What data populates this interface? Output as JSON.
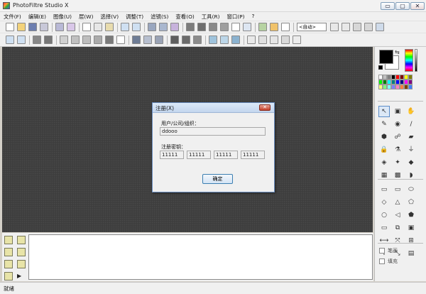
{
  "window": {
    "title": "PhotoFiltre Studio X",
    "controls": {
      "minimize": "▭",
      "maximize": "▢",
      "close": "✕"
    }
  },
  "menu": [
    "文件(F)",
    "编辑(E)",
    "图像(U)",
    "层(W)",
    "选择(V)",
    "调整(T)",
    "滤镜(S)",
    "查看(O)",
    "工具(R)",
    "窗口(P)",
    "?"
  ],
  "toolbar": {
    "zoom_value": "<自动>"
  },
  "dialog": {
    "title": "注册(X)",
    "close": "✕",
    "user_label": "用户/公司/组织：",
    "user_value": "ddooo",
    "key_label": "注册密钥：",
    "key_parts": [
      "11111",
      "11111",
      "11111",
      "11111"
    ],
    "ok_label": "确定"
  },
  "palette": {
    "swatches": [
      "#ffffff",
      "#c0c0c0",
      "#808080",
      "#000000",
      "#ff0000",
      "#800000",
      "#ffff00",
      "#808000",
      "#00ff00",
      "#008000",
      "#00ffff",
      "#008080",
      "#0000ff",
      "#000080",
      "#ff00ff",
      "#800080",
      "#ffff80",
      "#80ff80",
      "#80ffff",
      "#8080ff",
      "#ff80c0",
      "#ff8040",
      "#804000",
      "#4080ff"
    ]
  },
  "tools": {
    "top": [
      "↖",
      "▣",
      "✋",
      "✎",
      "◉",
      "/",
      "⬢",
      "☍",
      "▰",
      "🔒",
      "⚗",
      "⏚",
      "◈",
      "✦",
      "◆",
      "▦",
      "▩",
      "◗"
    ],
    "shapes": [
      "▭",
      "▭",
      "⬭",
      "◇",
      "△",
      "⬠",
      "○",
      "◁",
      "⬟",
      "▭",
      "⧉",
      "▣",
      "⟷",
      "⤧",
      "⊞",
      "I",
      "⤡",
      "▤"
    ]
  },
  "options": {
    "brush_label": "笔画",
    "fill_label": "填充"
  },
  "status": {
    "text": "就绪"
  }
}
